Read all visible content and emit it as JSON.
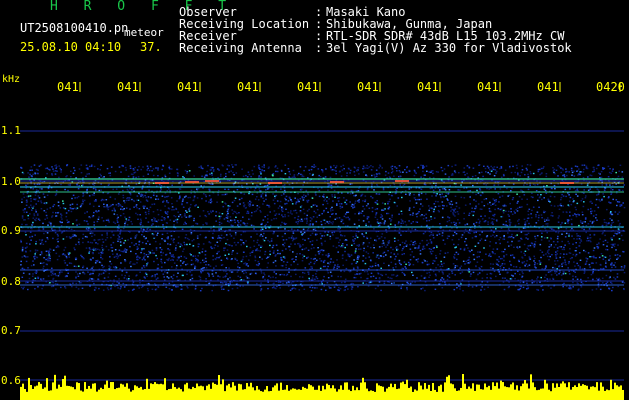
{
  "app": {
    "name": "H R O F F T",
    "filename": "UT2508100410.pn",
    "mode": "meteor",
    "datetime": "25.08.10 04:10",
    "count": "37."
  },
  "header": {
    "rows": [
      {
        "label": "Observer",
        "sep": ":",
        "value": "Masaki Kano"
      },
      {
        "label": "Receiving Location",
        "sep": ":",
        "value": "Shibukawa, Gunma, Japan"
      },
      {
        "label": "Receiver",
        "sep": ":",
        "value": "RTL-SDR SDR# 43dB L15 103.2MHz CW"
      },
      {
        "label": "Receiving Antenna",
        "sep": ":",
        "value": "3el Yagi(V) Az 330 for Vladivostok"
      }
    ]
  },
  "axis": {
    "unit": "kHz",
    "time_labels": [
      "041",
      "041",
      "041",
      "041",
      "041",
      "041",
      "041",
      "041",
      "041",
      "0420"
    ],
    "freq_ticks": [
      "1.1",
      "1.0",
      "0.9",
      "0.8",
      "0.7",
      "0.6"
    ]
  },
  "colors": {
    "background": "#000000",
    "accent_yellow": "#ffff00",
    "title_green": "#19c84a",
    "text_white": "#ffffff",
    "grid_blue": "#1a2a9a"
  }
}
